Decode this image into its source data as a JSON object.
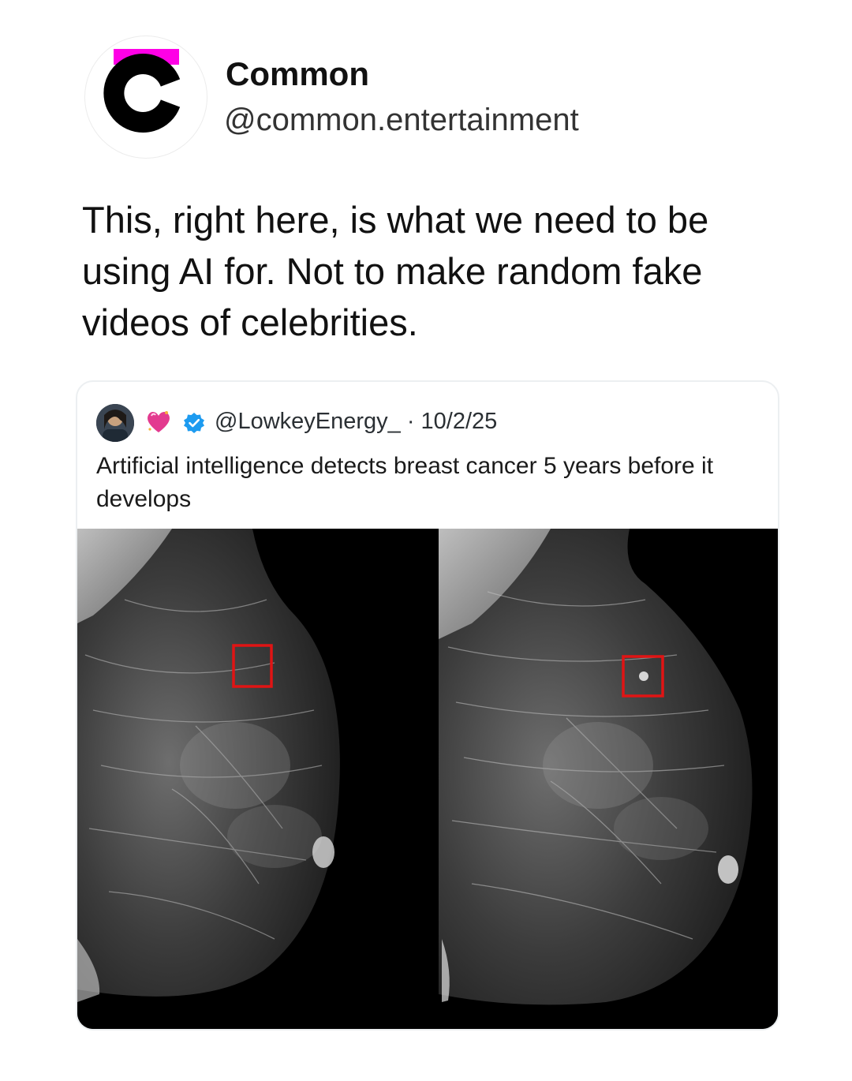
{
  "post": {
    "author": {
      "display_name": "Common",
      "handle": "@common.entertainment",
      "avatar_icon": "common-logo-icon",
      "brand_colors": {
        "accent": "#ff00e6",
        "logo": "#000000"
      }
    },
    "text": "This, right here, is what we need to be using AI for. Not to make random fake videos of celebrities."
  },
  "quoted_post": {
    "avatar_icon": "user-avatar-photo",
    "emoji_icon": "heart-emoji-icon",
    "badge_icon": "verified-badge-icon",
    "badge_color": "#1d9bf0",
    "meta": "@LowkeyEnergy_ · 10/2/25",
    "text": "Artificial intelligence detects breast cancer 5 years before it develops",
    "media": {
      "description_icon": "mammogram-images",
      "highlight_color": "#e01414"
    }
  }
}
